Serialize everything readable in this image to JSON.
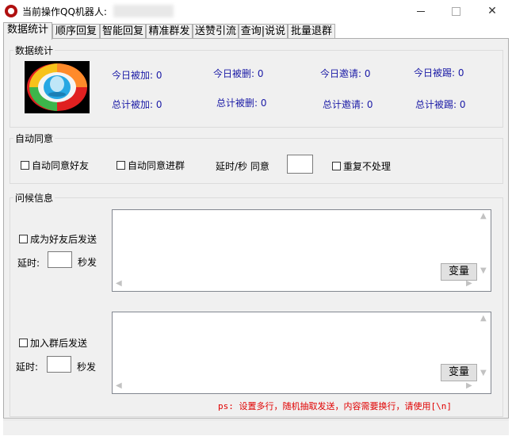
{
  "window": {
    "title": "当前操作QQ机器人:",
    "close_glyph": "✕"
  },
  "tabs": [
    {
      "label": "数据统计",
      "active": true
    },
    {
      "label": "顺序回复",
      "active": false
    },
    {
      "label": "智能回复",
      "active": false
    },
    {
      "label": "精准群发",
      "active": false
    },
    {
      "label": "送赞引流",
      "active": false
    },
    {
      "label": "查询|说说",
      "active": false
    },
    {
      "label": "批量退群",
      "active": false
    }
  ],
  "stats_group": {
    "title": "数据统计",
    "today_added": "今日被加: 0",
    "today_deleted": "今日被删: 0",
    "today_invited": "今日邀请: 0",
    "today_kicked": "今日被踢: 0",
    "total_added": "总计被加: 0",
    "total_deleted": "总计被删: 0",
    "total_invited": "总计邀请: 0",
    "total_kicked": "总计被踢: 0"
  },
  "auto_agree_group": {
    "title": "自动同意",
    "auto_friend": "自动同意好友",
    "auto_group": "自动同意进群",
    "delay_label": "延时/秒  同意",
    "delay_value": "",
    "no_repeat": "重复不处理"
  },
  "greeting_group": {
    "title": "问候信息",
    "friend_send": "成为好友后发送",
    "delay_prefix": "延时:",
    "delay_suffix": "秒发",
    "delay1_value": "",
    "group_send": "加入群后发送",
    "delay2_value": "",
    "variable_button": "变量",
    "ps_note": "ps: 设置多行，随机抽取发送，内容需要换行，请使用[\\n]"
  },
  "colors": {
    "stat_text": "#1a1aa6",
    "note_text": "#e00000",
    "panel_bg": "#f0f0f0"
  }
}
